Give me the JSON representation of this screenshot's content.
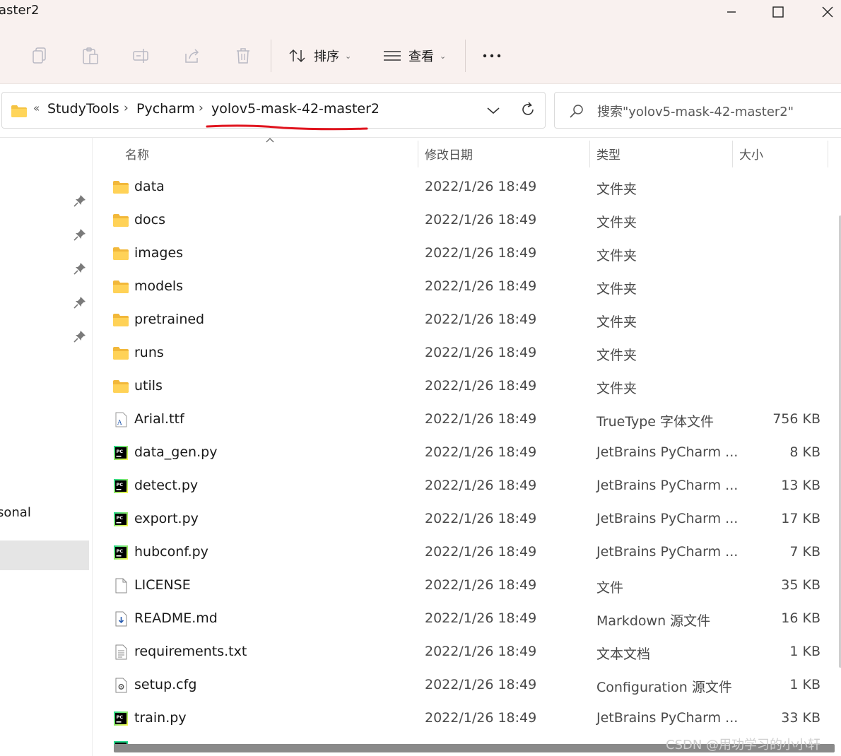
{
  "window": {
    "title": "aster2"
  },
  "toolbar": {
    "sort_label": "排序",
    "view_label": "查看"
  },
  "address": {
    "overflow_glyph": "«",
    "crumbs": [
      "StudyTools",
      "Pycharm",
      "yolov5-mask-42-master2"
    ],
    "separator": "›",
    "annotation_color": "#e0141e"
  },
  "search": {
    "placeholder": "搜索\"yolov5-mask-42-master2\""
  },
  "nav": {
    "visible_label": "sonal"
  },
  "columns": {
    "name": "名称",
    "date": "修改日期",
    "type": "类型",
    "size": "大小"
  },
  "files": [
    {
      "name": "data",
      "date": "2022/1/26 18:49",
      "type": "文件夹",
      "size": "",
      "icon": "folder-icon"
    },
    {
      "name": "docs",
      "date": "2022/1/26 18:49",
      "type": "文件夹",
      "size": "",
      "icon": "folder-icon"
    },
    {
      "name": "images",
      "date": "2022/1/26 18:49",
      "type": "文件夹",
      "size": "",
      "icon": "folder-icon"
    },
    {
      "name": "models",
      "date": "2022/1/26 18:49",
      "type": "文件夹",
      "size": "",
      "icon": "folder-icon"
    },
    {
      "name": "pretrained",
      "date": "2022/1/26 18:49",
      "type": "文件夹",
      "size": "",
      "icon": "folder-icon"
    },
    {
      "name": "runs",
      "date": "2022/1/26 18:49",
      "type": "文件夹",
      "size": "",
      "icon": "folder-icon"
    },
    {
      "name": "utils",
      "date": "2022/1/26 18:49",
      "type": "文件夹",
      "size": "",
      "icon": "folder-icon"
    },
    {
      "name": "Arial.ttf",
      "date": "2022/1/26 18:49",
      "type": "TrueType 字体文件",
      "size": "756 KB",
      "icon": "font-file-icon"
    },
    {
      "name": "data_gen.py",
      "date": "2022/1/26 18:49",
      "type": "JetBrains PyCharm ...",
      "size": "8 KB",
      "icon": "pycharm-file-icon"
    },
    {
      "name": "detect.py",
      "date": "2022/1/26 18:49",
      "type": "JetBrains PyCharm ...",
      "size": "13 KB",
      "icon": "pycharm-file-icon"
    },
    {
      "name": "export.py",
      "date": "2022/1/26 18:49",
      "type": "JetBrains PyCharm ...",
      "size": "17 KB",
      "icon": "pycharm-file-icon"
    },
    {
      "name": "hubconf.py",
      "date": "2022/1/26 18:49",
      "type": "JetBrains PyCharm ...",
      "size": "7 KB",
      "icon": "pycharm-file-icon"
    },
    {
      "name": "LICENSE",
      "date": "2022/1/26 18:49",
      "type": "文件",
      "size": "35 KB",
      "icon": "blank-file-icon"
    },
    {
      "name": "README.md",
      "date": "2022/1/26 18:49",
      "type": "Markdown 源文件",
      "size": "16 KB",
      "icon": "markdown-file-icon"
    },
    {
      "name": "requirements.txt",
      "date": "2022/1/26 18:49",
      "type": "文本文档",
      "size": "1 KB",
      "icon": "text-file-icon"
    },
    {
      "name": "setup.cfg",
      "date": "2022/1/26 18:49",
      "type": "Configuration 源文件",
      "size": "1 KB",
      "icon": "config-file-icon"
    },
    {
      "name": "train.py",
      "date": "2022/1/26 18:49",
      "type": "JetBrains PyCharm ...",
      "size": "33 KB",
      "icon": "pycharm-file-icon"
    }
  ],
  "watermark": "CSDN @用功学习的小小轩"
}
